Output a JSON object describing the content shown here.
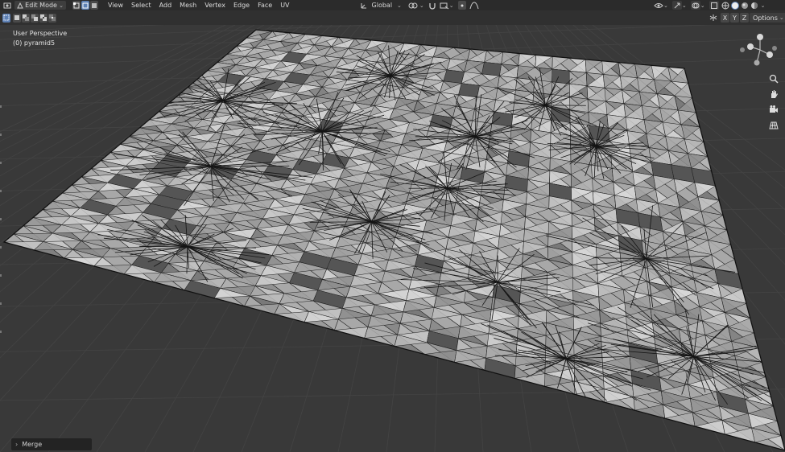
{
  "header": {
    "mode": "Edit Mode",
    "menus": [
      "View",
      "Select",
      "Add",
      "Mesh",
      "Vertex",
      "Edge",
      "Face",
      "UV"
    ],
    "transform_orientation": "Global",
    "options_label": "Options",
    "axes": [
      "X",
      "Y",
      "Z"
    ]
  },
  "viewport": {
    "view_name": "User Perspective",
    "object_label": "(0) pyramid5"
  },
  "operator_panel": {
    "label": "Merge"
  },
  "icons": {
    "mode": "edit-mode-icon",
    "select_vertex": "vertex-select-icon",
    "select_edge": "edge-select-icon",
    "select_face": "face-select-icon",
    "orientation": "transform-orientation-icon",
    "pivot": "pivot-point-icon",
    "snap": "snap-icon",
    "proportional": "proportional-editing-icon",
    "zoom": "zoom-icon",
    "pan": "hand-icon",
    "camera": "camera-icon",
    "grid": "grid-view-icon"
  },
  "colors": {
    "background": "#393939",
    "header": "#2b2b2b",
    "mesh_face": "#a9a9a9",
    "mesh_edge": "#1a1a1a",
    "active_button": "#5e81b5"
  }
}
